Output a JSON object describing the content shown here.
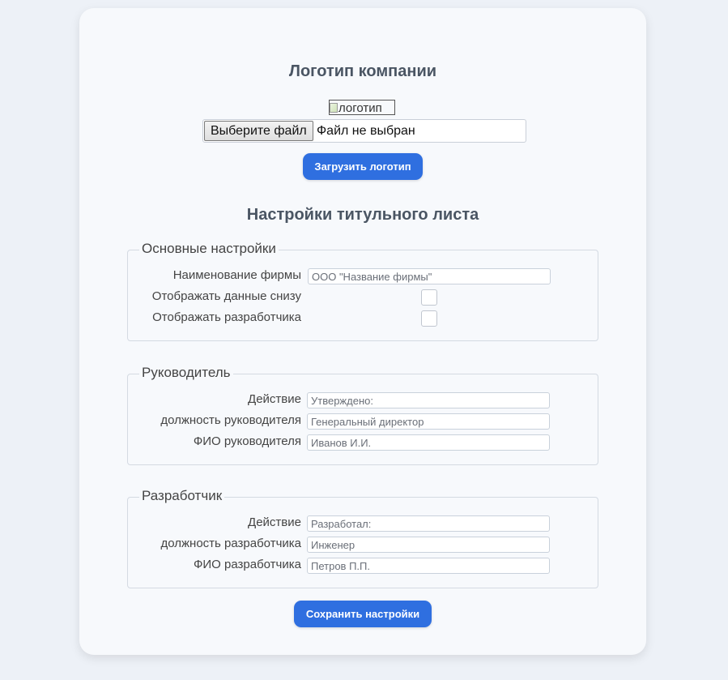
{
  "logo_section": {
    "title": "Логотип компании",
    "logo_alt": "логотип",
    "file_button_label": "Выберите файл",
    "file_status": "Файл не выбран",
    "upload_button_label": "Загрузить логотип"
  },
  "settings": {
    "title": "Настройки титульного листа",
    "basic": {
      "legend": "Основные настройки",
      "company_name_label": "Наименование фирмы",
      "company_name_placeholder": "ООО \"Название фирмы\"",
      "show_bottom_label": "Отображать данные снизу",
      "show_developer_label": "Отображать разработчика"
    },
    "manager": {
      "legend": "Руководитель",
      "action_label": "Действие",
      "action_placeholder": "Утверждено:",
      "position_label": "должность руководителя",
      "position_placeholder": "Генеральный директор",
      "name_label": "ФИО руководителя",
      "name_placeholder": "Иванов И.И."
    },
    "developer": {
      "legend": "Разработчик",
      "action_label": "Действие",
      "action_placeholder": "Разработал:",
      "position_label": "должность разработчика",
      "position_placeholder": "Инженер",
      "name_label": "ФИО разработчика",
      "name_placeholder": "Петров П.П."
    },
    "save_button_label": "Сохранить настройки"
  },
  "colors": {
    "background": "#edf1f7",
    "card": "#f7f9fc",
    "accent": "#2f6fe0",
    "heading": "#4a5563"
  }
}
